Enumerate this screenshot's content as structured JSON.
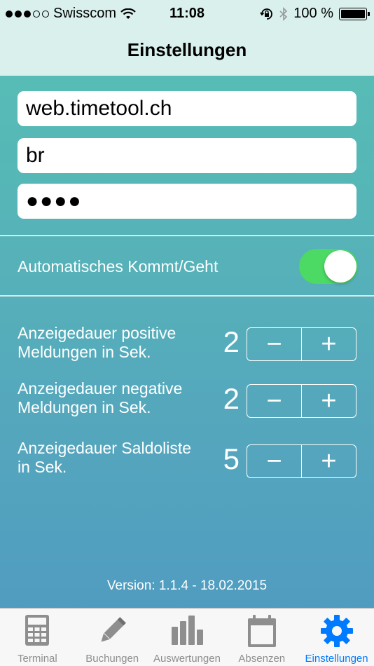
{
  "status_bar": {
    "carrier": "Swisscom",
    "time": "11:08",
    "battery": "100 %",
    "signal_bars": 3
  },
  "nav": {
    "title": "Einstellungen"
  },
  "fields": {
    "server": "web.timetool.ch",
    "user": "br",
    "password": "●●●●"
  },
  "auto_toggle": {
    "label": "Automatisches Kommt/Geht",
    "on": true
  },
  "settings": [
    {
      "line1": "Anzeigedauer positive",
      "line2": "Meldungen in Sek.",
      "value": "2"
    },
    {
      "line1": "Anzeigedauer negative",
      "line2": "Meldungen in Sek.",
      "value": "2"
    },
    {
      "line1": "Anzeigedauer Saldoliste",
      "line2": "in Sek.",
      "value": "5"
    }
  ],
  "stepper": {
    "minus": "−",
    "plus": "+"
  },
  "version": "Version: 1.1.4 - 18.02.2015",
  "tabs": [
    {
      "label": "Terminal",
      "icon": "calculator-icon"
    },
    {
      "label": "Buchungen",
      "icon": "pencil-icon"
    },
    {
      "label": "Auswertungen",
      "icon": "bar-chart-icon"
    },
    {
      "label": "Absenzen",
      "icon": "calendar-icon"
    },
    {
      "label": "Einstellungen",
      "icon": "gear-icon"
    }
  ],
  "colors": {
    "accent": "#007aff",
    "toggle_on": "#4cd964",
    "tab_inactive": "#8e8e8e"
  }
}
